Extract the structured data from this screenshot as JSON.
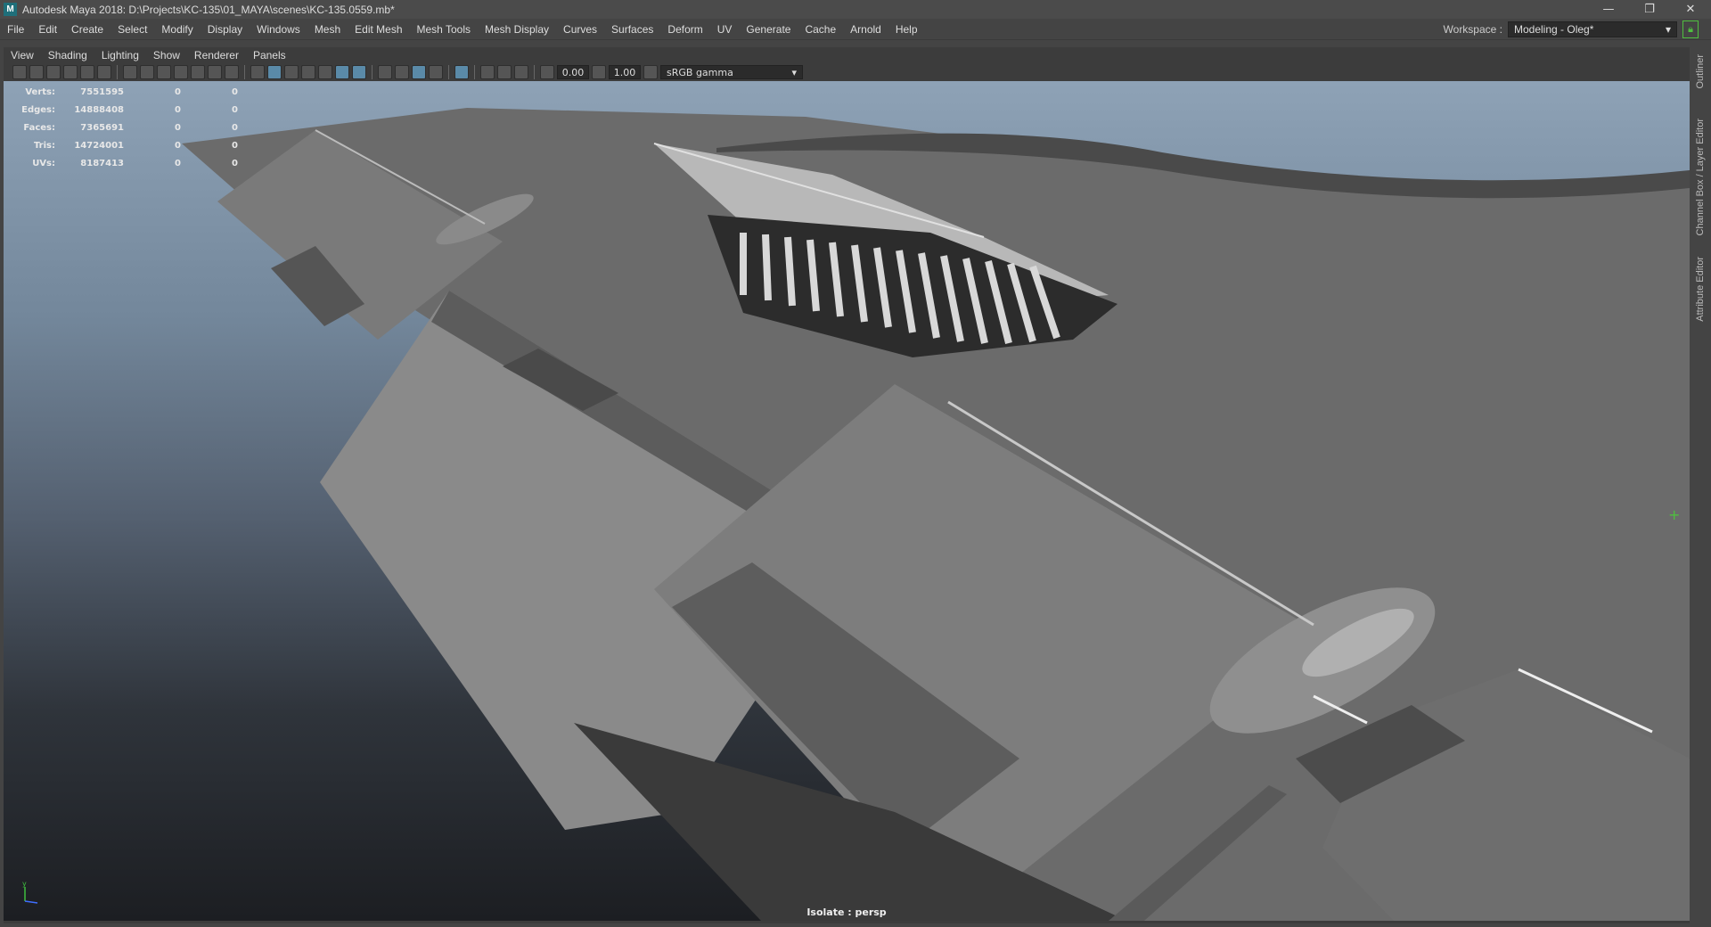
{
  "titlebar": {
    "logo": "M",
    "title": "Autodesk Maya 2018: D:\\Projects\\KC-135\\01_MAYA\\scenes\\KC-135.0559.mb*",
    "minimize": "—",
    "restore": "❐",
    "close": "✕"
  },
  "menubar": {
    "items": [
      "File",
      "Edit",
      "Create",
      "Select",
      "Modify",
      "Display",
      "Windows",
      "Mesh",
      "Edit Mesh",
      "Mesh Tools",
      "Mesh Display",
      "Curves",
      "Surfaces",
      "Deform",
      "UV",
      "Generate",
      "Cache",
      "Arnold",
      "Help"
    ],
    "workspace_label": "Workspace :",
    "workspace_value": "Modeling - Oleg*"
  },
  "panel": {
    "menu": [
      "View",
      "Shading",
      "Lighting",
      "Show",
      "Renderer",
      "Panels"
    ],
    "exposure": "0.00",
    "gamma": "1.00",
    "colorspace": "sRGB gamma"
  },
  "hud": {
    "rows": [
      {
        "label": "Verts:",
        "v1": "7551595",
        "v2": "0",
        "v3": "0"
      },
      {
        "label": "Edges:",
        "v1": "14888408",
        "v2": "0",
        "v3": "0"
      },
      {
        "label": "Faces:",
        "v1": "7365691",
        "v2": "0",
        "v3": "0"
      },
      {
        "label": "Tris:",
        "v1": "14724001",
        "v2": "0",
        "v3": "0"
      },
      {
        "label": "UVs:",
        "v1": "8187413",
        "v2": "0",
        "v3": "0"
      }
    ]
  },
  "viewport": {
    "isolate_label": "Isolate : persp",
    "axis_y": "y",
    "plus": "+"
  },
  "side_tabs": [
    "Outliner",
    "Channel Box / Layer Editor",
    "Attribute Editor"
  ],
  "colors": {
    "accent_green": "#4fbf3f",
    "menu_bg": "#444444"
  }
}
